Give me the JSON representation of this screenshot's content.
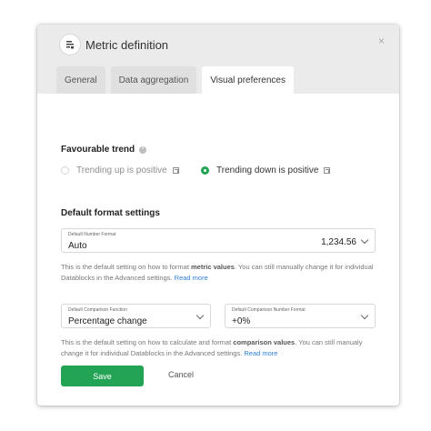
{
  "dialog": {
    "title": "Metric definition",
    "close_icon": "×"
  },
  "tabs": [
    {
      "label": "General",
      "active": false
    },
    {
      "label": "Data aggregation",
      "active": false
    },
    {
      "label": "Visual preferences",
      "active": true
    }
  ],
  "favourable_trend": {
    "label": "Favourable trend",
    "options": [
      {
        "label": "Trending up is positive",
        "selected": false
      },
      {
        "label": "Trending down is positive",
        "selected": true
      }
    ]
  },
  "default_format": {
    "label": "Default format settings",
    "number_format": {
      "caption": "Default Number Format",
      "value": "Auto",
      "example": "1,234.56"
    },
    "help_1_a": "This is the default setting on how to format ",
    "help_1_bold": "metric values",
    "help_1_b": ". You can still manually change it for individual Datablocks in the Advanced settings. ",
    "help_1_link": "Read more",
    "comparison_function": {
      "caption": "Default Comparison Function",
      "value": "Percentage change"
    },
    "comparison_number_format": {
      "caption": "Default Comparison Number Format",
      "value": "+0%"
    },
    "help_2_a": "This is the default setting on how to calculate and format ",
    "help_2_bold": "comparison values",
    "help_2_b": ". You can still manualy change it for individual Datablocks in the Advanced settings. ",
    "help_2_link": "Read more"
  },
  "footer": {
    "save_label": "Save",
    "cancel_label": "Cancel"
  },
  "colors": {
    "accent": "#23a455",
    "link": "#2f7fd6",
    "header_bg": "#ebebeb"
  }
}
